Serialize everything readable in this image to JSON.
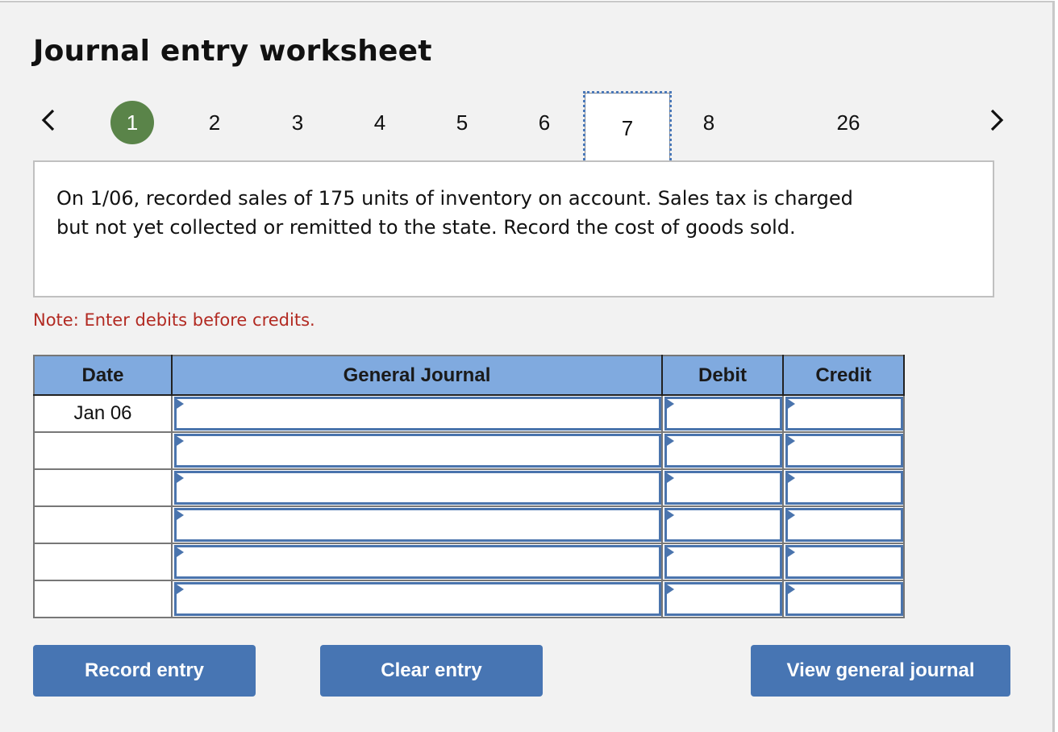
{
  "header": {
    "title": "Journal entry worksheet"
  },
  "pagination": {
    "prev_icon": "chevron-left-icon",
    "next_icon": "chevron-right-icon",
    "steps": [
      "1",
      "2",
      "3",
      "4",
      "5",
      "6",
      "7",
      "8",
      "26"
    ],
    "active_step": "1",
    "focused_step": "7"
  },
  "description": {
    "text": "On 1/06, recorded sales of 175 units of inventory on account. Sales tax is charged but not yet collected or remitted to the state. Record the cost of goods sold."
  },
  "note": "Note: Enter debits before credits.",
  "journal_table": {
    "columns": [
      "Date",
      "General Journal",
      "Debit",
      "Credit"
    ],
    "rows": [
      {
        "date": "Jan 06",
        "account": "",
        "debit": "",
        "credit": ""
      },
      {
        "date": "",
        "account": "",
        "debit": "",
        "credit": ""
      },
      {
        "date": "",
        "account": "",
        "debit": "",
        "credit": ""
      },
      {
        "date": "",
        "account": "",
        "debit": "",
        "credit": ""
      },
      {
        "date": "",
        "account": "",
        "debit": "",
        "credit": ""
      },
      {
        "date": "",
        "account": "",
        "debit": "",
        "credit": ""
      }
    ]
  },
  "buttons": {
    "record": "Record entry",
    "clear": "Clear entry",
    "view": "View general journal"
  },
  "colors": {
    "active_step": "#5a8449",
    "header_bg": "#80aadf",
    "button_bg": "#4775b3",
    "note_text": "#b22a22",
    "input_border": "#4a74ad"
  }
}
